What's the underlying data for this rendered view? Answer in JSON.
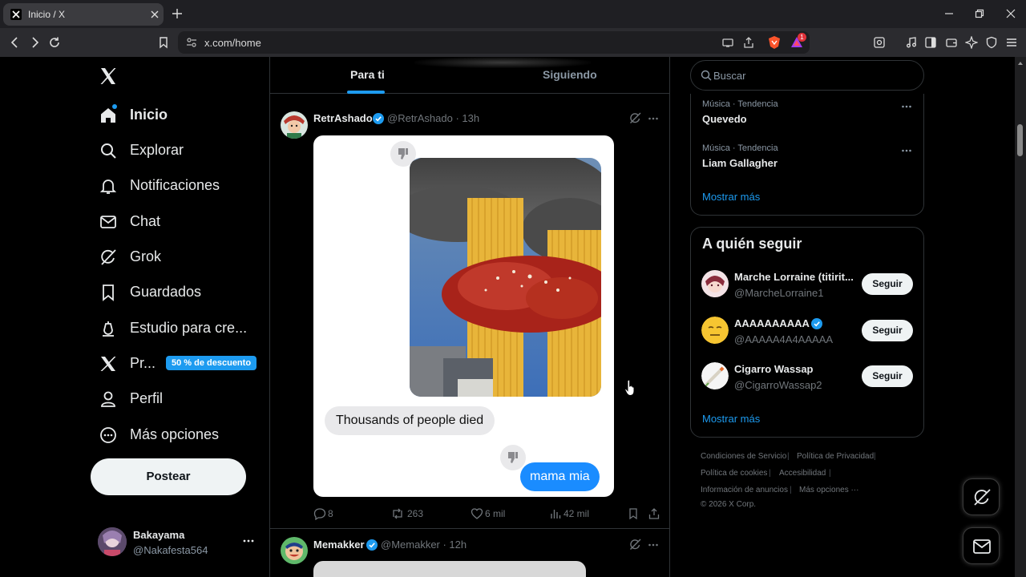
{
  "browser": {
    "tab_title": "Inicio / X",
    "url": "x.com/home",
    "notif_count": "1"
  },
  "sidebar": {
    "items": [
      {
        "label": "Inicio"
      },
      {
        "label": "Explorar"
      },
      {
        "label": "Notificaciones"
      },
      {
        "label": "Chat"
      },
      {
        "label": "Grok"
      },
      {
        "label": "Guardados"
      },
      {
        "label": "Estudio para cre..."
      },
      {
        "label": "Pr..."
      },
      {
        "label": "Perfil"
      },
      {
        "label": "Más opciones"
      }
    ],
    "premium_badge": "50 % de descuento",
    "post_button": "Postear",
    "account": {
      "name": "Bakayama",
      "handle": "@Nakafesta564"
    }
  },
  "timeline": {
    "tabs": [
      "Para ti",
      "Siguiendo"
    ],
    "posts": [
      {
        "name": "RetrAshado",
        "handle": "@RetrAshado · 13h",
        "bubble_gray": "Thousands of people died",
        "bubble_blue": "mama mia",
        "replies": "8",
        "reposts": "263",
        "likes": "6 mil",
        "views": "42 mil"
      },
      {
        "name": "Memakker",
        "handle": "@Memakker · 12h"
      }
    ]
  },
  "right": {
    "search_placeholder": "Buscar",
    "trends": [
      {
        "meta": "Música · Tendencia",
        "name": "Quevedo"
      },
      {
        "meta": "Música · Tendencia",
        "name": "Liam Gallagher"
      }
    ],
    "trends_show_more": "Mostrar más",
    "who_to_follow": {
      "title": "A quién seguir",
      "accounts": [
        {
          "name": "Marche Lorraine (titirit...",
          "handle": "@MarcheLorraine1",
          "button": "Seguir"
        },
        {
          "name": "AAAAAAAAAA",
          "handle": "@AAAAA4A4AAAAA",
          "button": "Seguir"
        },
        {
          "name": "Cigarro Wassap",
          "handle": "@CigarroWassap2",
          "button": "Seguir"
        }
      ],
      "show_more": "Mostrar más"
    },
    "footer": {
      "links": [
        "Condiciones de Servicio",
        "Política de Privacidad",
        "Política de cookies",
        "Accesibilidad",
        "Información de anuncios",
        "Más opciones ···"
      ],
      "copyright": "© 2026 X Corp."
    }
  },
  "colors": {
    "accent": "#1d9bf0",
    "background": "#000000",
    "border": "#2f3336"
  }
}
